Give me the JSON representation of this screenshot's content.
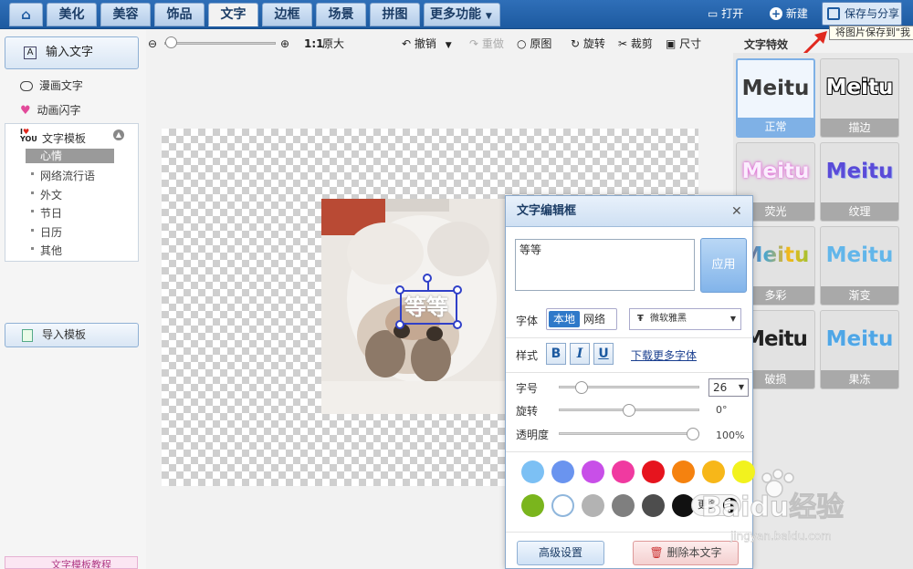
{
  "nav": {
    "tabs": [
      {
        "label": "美化"
      },
      {
        "label": "美容"
      },
      {
        "label": "饰品"
      },
      {
        "label": "文字"
      },
      {
        "label": "边框"
      },
      {
        "label": "场景"
      },
      {
        "label": "拼图"
      },
      {
        "label": "更多功能"
      }
    ],
    "active_tab": "文字",
    "open_label": "打开",
    "new_label": "新建",
    "save_share_label": "保存与分享",
    "tooltip": "将图片保存到\"我"
  },
  "left_panel": {
    "input_text_label": "输入文字",
    "comic_text_label": "漫画文字",
    "animated_text_label": "动画闪字",
    "template_title": "文字模板",
    "template_items": [
      "心情",
      "网络流行语",
      "外文",
      "节日",
      "日历",
      "其他"
    ],
    "selected_template": "心情",
    "import_template_label": "导入模板",
    "bottom_link": "文字模板教程"
  },
  "toolbar": {
    "zoom_ratio_label": "1:1",
    "original_size_label": "原大",
    "undo_label": "撤销",
    "redo_label": "重做",
    "original_label": "原图",
    "rotate_label": "旋转",
    "crop_label": "裁剪",
    "size_label": "尺寸"
  },
  "canvas": {
    "overlay_text": "等等"
  },
  "dialog": {
    "title": "文字编辑框",
    "text_value": "等等",
    "apply_label": "应用",
    "font_label": "字体",
    "font_local": "本地",
    "font_network": "网络",
    "font_name": "微软雅黑",
    "style_label": "样式",
    "bold_label": "B",
    "italic_label": "I",
    "underline_label": "U",
    "download_fonts_label": "下载更多字体",
    "size_label": "字号",
    "size_value": "26",
    "rotate_label": "旋转",
    "rotate_value": "0°",
    "opacity_label": "透明度",
    "opacity_value": "100%",
    "size_slider_level": 0.13,
    "rotate_slider_level": 0.5,
    "opacity_slider_level": 1.0,
    "colors": [
      "#7cc0f4",
      "#6a94ef",
      "#c84fe8",
      "#f03aa0",
      "#e6141e",
      "#f5820f",
      "#f7b719",
      "#f2f21e",
      "#7ab51d",
      "#ffffff",
      "#b3b3b3",
      "#7f7f7f",
      "#4d4d4d",
      "#111111"
    ],
    "more_colors_label": "更多",
    "advanced_label": "高级设置",
    "delete_label": "删除本文字"
  },
  "effects": {
    "title": "文字特效",
    "sample": "Meitu",
    "items": [
      {
        "label": "正常",
        "color": "#3a3a3a"
      },
      {
        "label": "描边",
        "color": "#ffffff"
      },
      {
        "label": "荧光",
        "color": "#f7e6ff"
      },
      {
        "label": "纹理",
        "color": "#5a4bd8"
      },
      {
        "label": "多彩",
        "color": "#3aa4e0"
      },
      {
        "label": "渐变",
        "color": "#62b6ea"
      },
      {
        "label": "破损",
        "color": "#222222"
      },
      {
        "label": "果冻",
        "color": "#4fa6e6"
      }
    ],
    "selected": "正常"
  },
  "watermark": {
    "brand": "Baidu经验",
    "url": "jingyan.baidu.com"
  }
}
